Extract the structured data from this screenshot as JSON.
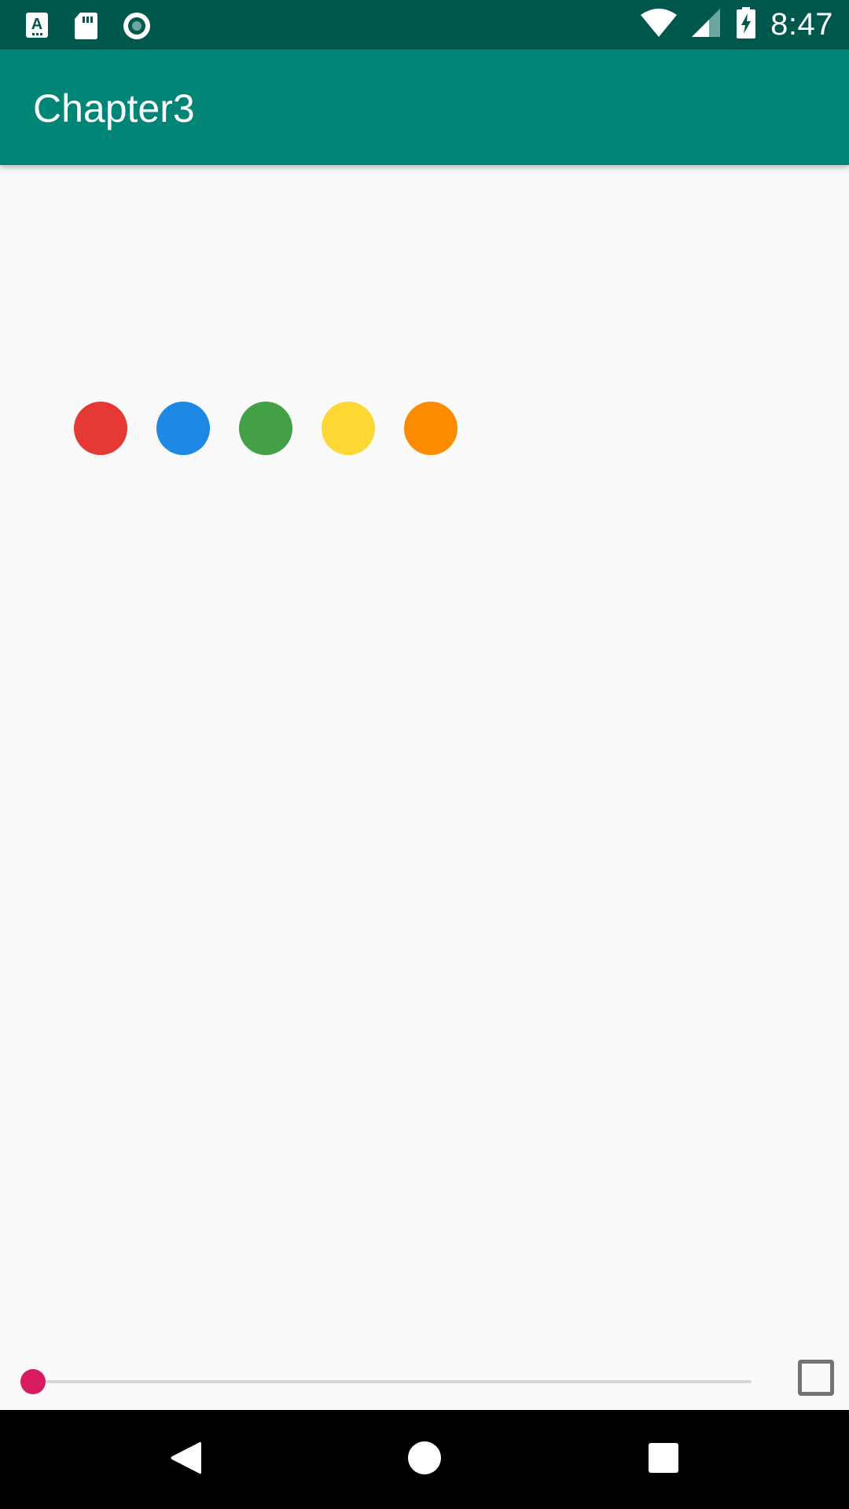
{
  "status_bar": {
    "time": "8:47",
    "left_icons": [
      "keyboard-a-icon",
      "sd-card-icon",
      "record-icon"
    ],
    "right_icons": [
      "wifi-icon",
      "signal-icon",
      "battery-charging-icon"
    ]
  },
  "app_bar": {
    "title": "Chapter3"
  },
  "dots": [
    {
      "color": "#e53935"
    },
    {
      "color": "#1e88e5"
    },
    {
      "color": "#43a047"
    },
    {
      "color": "#fdd835"
    },
    {
      "color": "#fb8c00"
    }
  ],
  "seekbar": {
    "progress": 0,
    "thumb_color": "#d81b60"
  },
  "checkbox": {
    "checked": false
  },
  "nav_bar": {
    "icons": [
      "back-icon",
      "home-icon",
      "recents-icon"
    ]
  },
  "colors": {
    "status_bar": "#00574b",
    "app_bar": "#008577",
    "background": "#fafafa"
  }
}
